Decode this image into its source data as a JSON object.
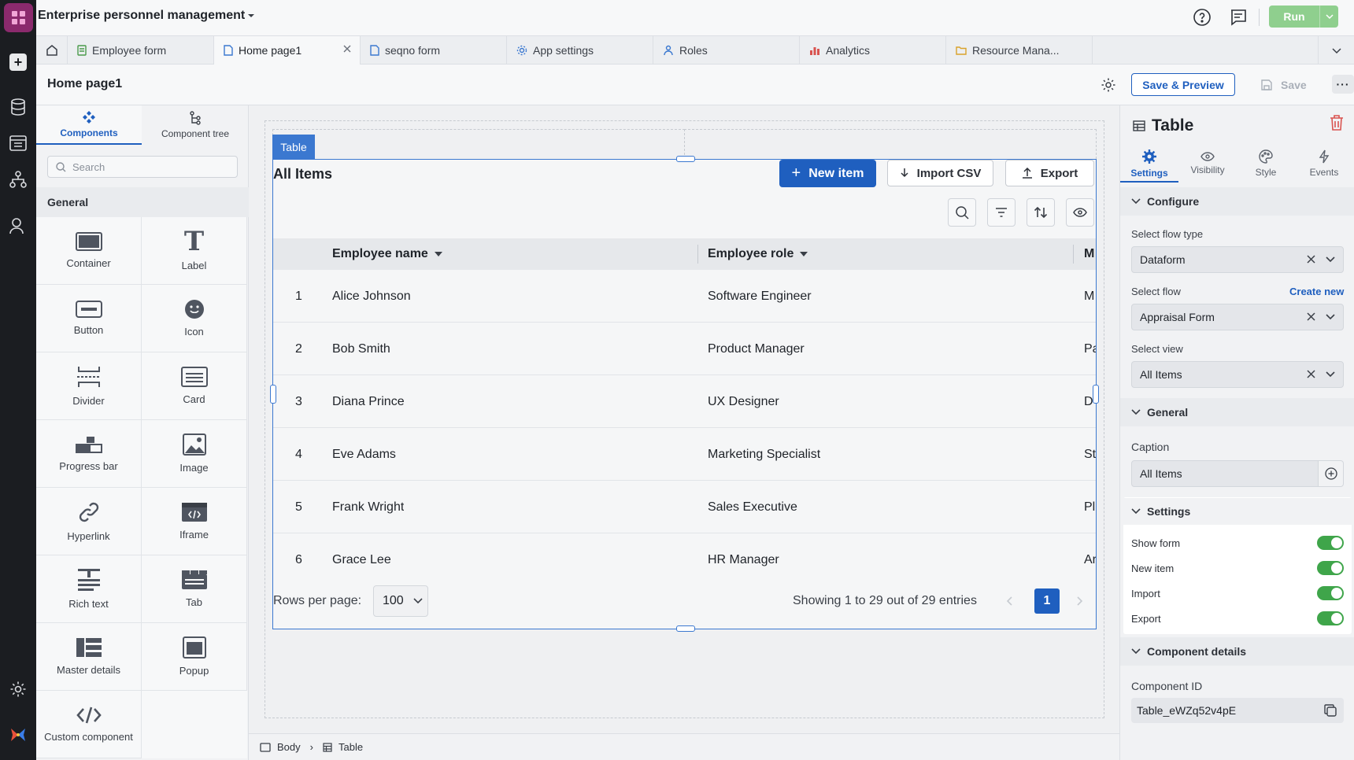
{
  "app": {
    "title": "Enterprise personnel management",
    "run_label": "Run"
  },
  "tabs": [
    {
      "label": "Employee form"
    },
    {
      "label": "Home page1"
    },
    {
      "label": "seqno form"
    },
    {
      "label": "App settings"
    },
    {
      "label": "Roles"
    },
    {
      "label": "Analytics"
    },
    {
      "label": "Resource Mana..."
    }
  ],
  "page": {
    "title": "Home page1",
    "save_preview_label": "Save & Preview",
    "save_label": "Save"
  },
  "components_panel": {
    "tab_components": "Components",
    "tab_tree": "Component tree",
    "search_placeholder": "Search",
    "section_general": "General",
    "items": [
      {
        "label": "Container"
      },
      {
        "label": "Label"
      },
      {
        "label": "Button"
      },
      {
        "label": "Icon"
      },
      {
        "label": "Divider"
      },
      {
        "label": "Card"
      },
      {
        "label": "Progress bar"
      },
      {
        "label": "Image"
      },
      {
        "label": "Hyperlink"
      },
      {
        "label": "Iframe"
      },
      {
        "label": "Rich text"
      },
      {
        "label": "Tab"
      },
      {
        "label": "Master details"
      },
      {
        "label": "Popup"
      },
      {
        "label": "Custom component"
      }
    ]
  },
  "table_widget": {
    "tag": "Table",
    "caption": "All Items",
    "new_item_label": "New item",
    "import_label": "Import CSV",
    "export_label": "Export",
    "columns": [
      "Employee name",
      "Employee role",
      "M"
    ],
    "rows": [
      {
        "num": "1",
        "name": "Alice Johnson",
        "role": "Software Engineer",
        "extra": "M"
      },
      {
        "num": "2",
        "name": "Bob Smith",
        "role": "Product Manager",
        "extra": "Pa"
      },
      {
        "num": "3",
        "name": "Diana Prince",
        "role": "UX Designer",
        "extra": "D"
      },
      {
        "num": "4",
        "name": "Eve Adams",
        "role": "Marketing Specialist",
        "extra": "St"
      },
      {
        "num": "5",
        "name": "Frank Wright",
        "role": "Sales Executive",
        "extra": "Pl"
      },
      {
        "num": "6",
        "name": "Grace Lee",
        "role": "HR Manager",
        "extra": "Ar"
      }
    ],
    "rows_per_page_label": "Rows per page:",
    "rows_per_page": "100",
    "showing": "Showing 1 to 29 out of 29 entries",
    "current_page": "1"
  },
  "breadcrumb": {
    "body": "Body",
    "table": "Table"
  },
  "props": {
    "title": "Table",
    "tabs": {
      "settings": "Settings",
      "visibility": "Visibility",
      "style": "Style",
      "events": "Events"
    },
    "configure": "Configure",
    "flow_type_label": "Select flow type",
    "flow_type": "Dataform",
    "flow_label": "Select flow",
    "create_new": "Create new",
    "flow": "Appraisal Form",
    "view_label": "Select view",
    "view": "All Items",
    "general": "General",
    "caption_label": "Caption",
    "caption": "All Items",
    "settings": "Settings",
    "toggles": [
      {
        "label": "Show form",
        "on": true
      },
      {
        "label": "New item",
        "on": true
      },
      {
        "label": "Import",
        "on": true
      },
      {
        "label": "Export",
        "on": true
      }
    ],
    "component_details": "Component details",
    "component_id_label": "Component ID",
    "component_id": "Table_eWZq52v4pE"
  },
  "colors": {
    "accent": "#1f5fbf",
    "selection": "#3b78d0",
    "toggle_on": "#3fa54a",
    "run": "#8fcf8e",
    "delete": "#d9534f"
  }
}
